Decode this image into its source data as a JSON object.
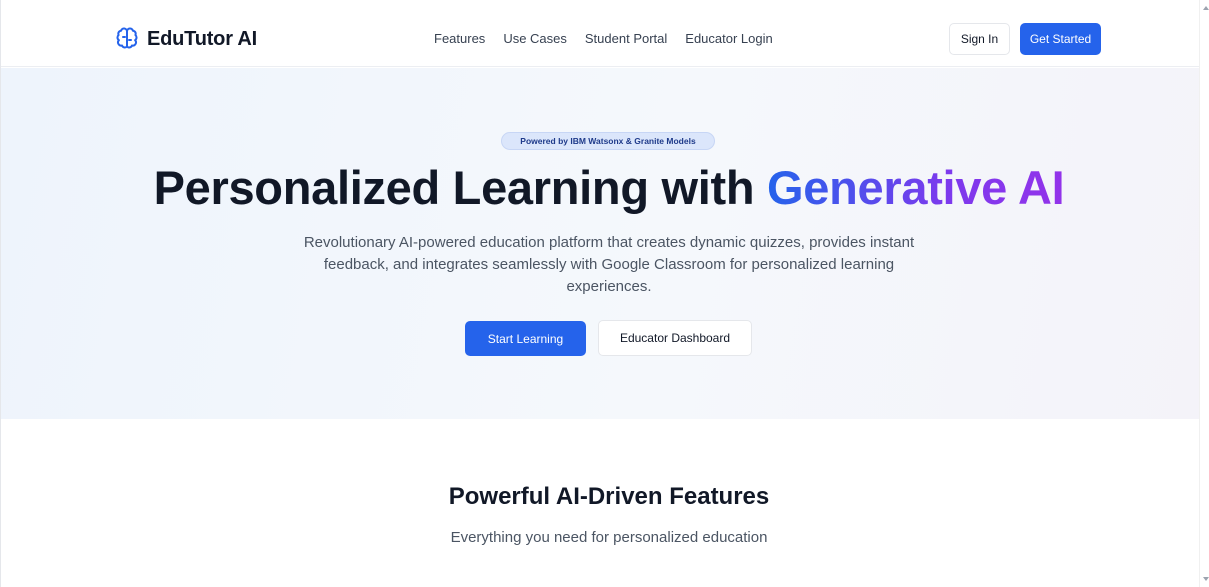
{
  "brand": {
    "name": "EduTutor AI",
    "icon": "brain-icon",
    "color": "#2563eb"
  },
  "nav": {
    "links": [
      "Features",
      "Use Cases",
      "Student Portal",
      "Educator Login"
    ],
    "sign_in": "Sign In",
    "get_started": "Get Started"
  },
  "hero": {
    "badge": "Powered by IBM Watsonx & Granite Models",
    "title_plain": "Personalized Learning with ",
    "title_highlight": "Generative AI",
    "subtitle": "Revolutionary AI-powered education platform that creates dynamic quizzes, provides instant feedback, and integrates seamlessly with Google Classroom for personalized learning experiences.",
    "primary_cta": "Start Learning",
    "secondary_cta": "Educator Dashboard"
  },
  "features": {
    "title": "Powerful AI-Driven Features",
    "subtitle": "Everything you need for personalized education"
  },
  "colors": {
    "accent": "#2563eb",
    "gradient_end": "#9333ea",
    "badge_bg": "#dbe6fb"
  }
}
